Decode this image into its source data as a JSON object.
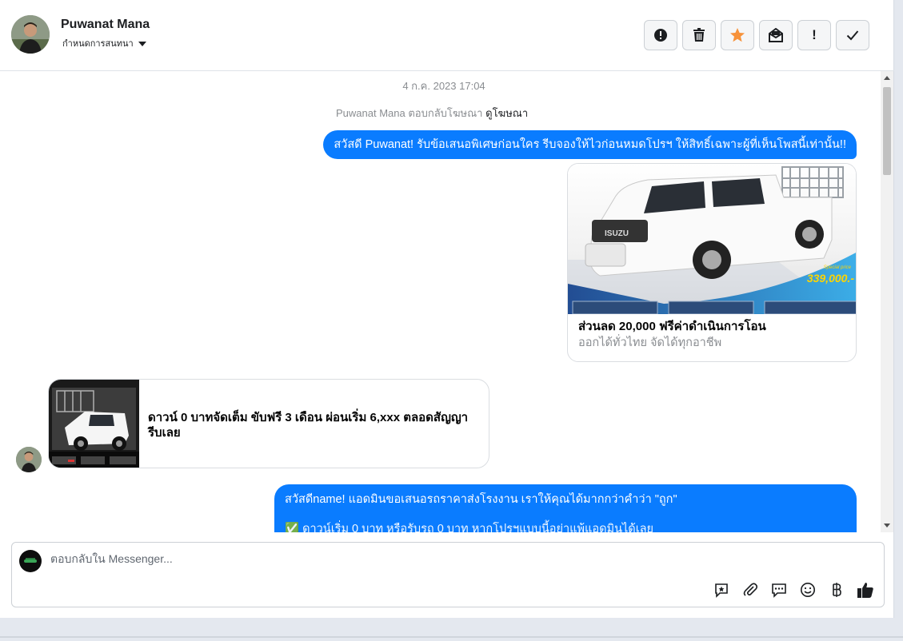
{
  "header": {
    "contact_name": "Puwanat Mana",
    "assign_label": "กำหนดการสนทนา",
    "actions": [
      {
        "name": "spam-button",
        "icon": "alert-circle-icon",
        "glyph": "!"
      },
      {
        "name": "delete-button",
        "icon": "trash-icon",
        "glyph": ""
      },
      {
        "name": "star-button",
        "icon": "star-icon",
        "glyph": "★"
      },
      {
        "name": "mark-unread-button",
        "icon": "envelope-icon",
        "glyph": ""
      },
      {
        "name": "follow-up-button",
        "icon": "exclamation-icon",
        "glyph": "!"
      },
      {
        "name": "done-button",
        "icon": "check-icon",
        "glyph": "✓"
      }
    ]
  },
  "chat": {
    "timestamp": "4 ก.ค. 2023 17:04",
    "reply_note": "Puwanat Mana ตอบกลับโฆษณา",
    "reply_link": "ดูโฆษณา",
    "message1": "สวัสดี Puwanat! รับข้อเสนอพิเศษก่อนใคร รีบจองให้ไวก่อนหมดโปรฯ ให้สิทธิ์เฉพาะผู้ที่เห็นโพสนี้เท่านั้น!!",
    "card1": {
      "price": "339,000.-",
      "badge": "Special price",
      "title": "ส่วนลด 20,000 ฟรีค่าดำเนินการโอน",
      "subtitle": "ออกได้ทั่วไทย จัดได้ทุกอาชีพ"
    },
    "card2": {
      "title": "ดาวน์ 0 บาทจัดเต็ม ขับฟรี 3 เดือน ผ่อนเริ่ม 6,xxx ตลอดสัญญา รีบเลย"
    },
    "message2_line1": "สวัสดีname! แอดมินขอเสนอรถราคาส่งโรงงาน เราให้คุณได้มากกว่าคำว่า \"ถูก\"",
    "message2_line2": "✅ ดาวน์เริ่ม 0 บาท หรือรับรถ 0 บาท หากโปรฯแบบนี้อย่าแพ้แอดมินได้เลย"
  },
  "composer": {
    "placeholder": "ตอบกลับใน Messenger..."
  },
  "colors": {
    "accent": "#0a7cff",
    "star": "#f7923a"
  }
}
